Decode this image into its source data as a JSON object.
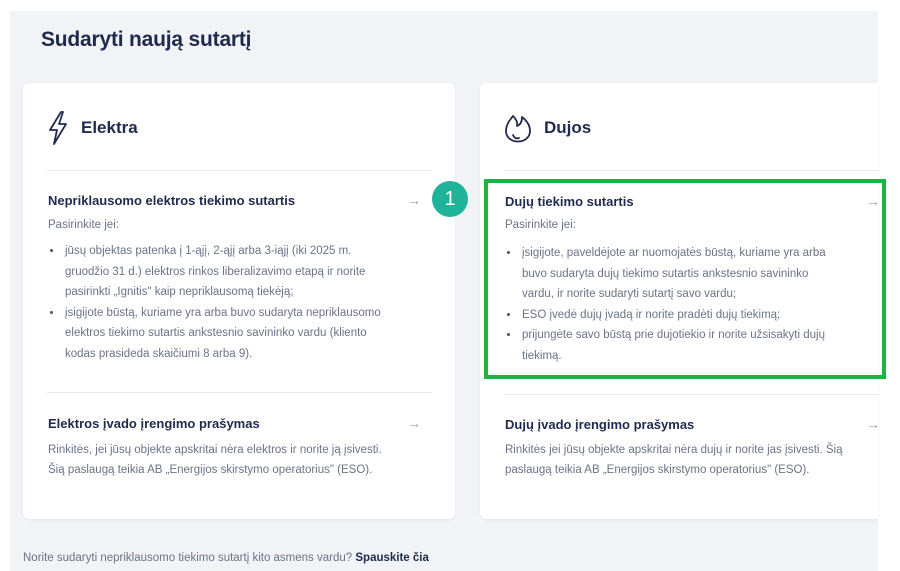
{
  "page": {
    "title": "Sudaryti naują sutartį"
  },
  "elektra": {
    "title": "Elektra",
    "icon": "lightning-icon",
    "section1": {
      "title": "Nepriklausomo elektros tiekimo sutartis",
      "intro": "Pasirinkite jei:",
      "bullets": [
        [
          "jūsų objektas patenka į 1-ąjį, 2-ąjį arba 3-iąjį (iki 2025 m.",
          "gruodžio 31 d.) elektros rinkos liberalizavimo etapą ir norite",
          "pasirinkti „Ignitis\" kaip nepriklausomą tiekėją;"
        ],
        [
          "įsigijote būstą, kuriame yra arba buvo sudaryta nepriklausomo",
          "elektros tiekimo sutartis ankstesnio savininko vardu (kliento",
          "kodas prasideda skaičiumi 8 arba 9)."
        ]
      ]
    },
    "section2": {
      "title": "Elektros įvado įrengimo prašymas",
      "desc": [
        "Rinkitės, jei jūsų objekte apskritai nėra elektros ir norite ją įsivesti.",
        "Šią paslaugą teikia AB „Energijos skirstymo operatorius\" (ESO)."
      ]
    }
  },
  "dujos": {
    "title": "Dujos",
    "icon": "flame-icon",
    "section1": {
      "title": "Dujų tiekimo sutartis",
      "intro": "Pasirinkite jei:",
      "bullets": [
        [
          "įsigijote, paveldėjote ar nuomojatės būstą, kuriame yra arba",
          "buvo sudaryta dujų tiekimo sutartis ankstesnio savininko",
          "vardu, ir norite sudaryti sutartį savo vardu;"
        ],
        [
          "ESO įvedė dujų įvadą ir norite pradėti dujų tiekimą;"
        ],
        [
          "prijungėte savo būstą prie dujotiekio ir norite užsisakyti dujų",
          "tiekimą."
        ]
      ]
    },
    "section2": {
      "title": "Dujų įvado įrengimo prašymas",
      "desc": [
        "Rinkitės jei jūsų objekte apskritai nėra dujų ir norite jas įsivesti. Šią",
        "paslaugą teikia AB „Energijos skirstymo operatorius\" (ESO)."
      ]
    }
  },
  "annotation": {
    "badge": "1",
    "highlight_color": "#1db446",
    "badge_color": "#1fb39a"
  },
  "footer": {
    "text": "Norite sudaryti nepriklausomo tiekimo sutartį kito asmens vardu?",
    "link": "Spauskite čia"
  },
  "arrow_glyph": "→"
}
